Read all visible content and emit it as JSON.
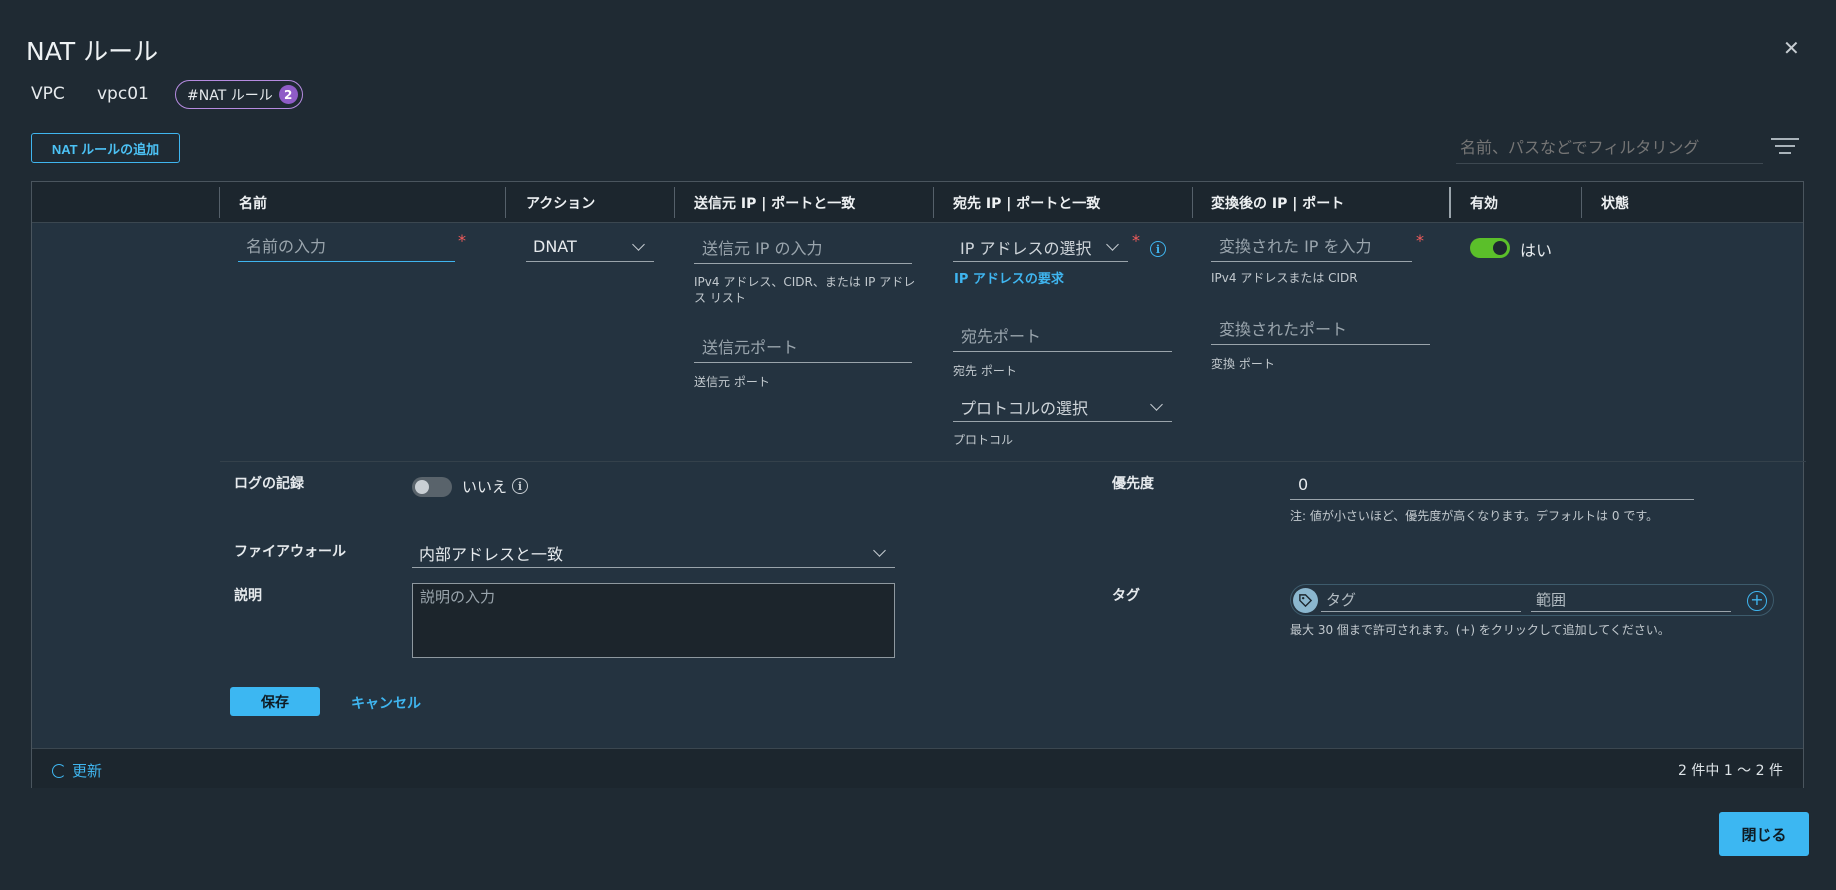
{
  "dialog": {
    "title": "NAT ルール",
    "close_icon": "close-icon",
    "close_button": "閉じる"
  },
  "breadcrumb": {
    "vpc_label": "VPC",
    "vpc_name": "vpc01",
    "chip_label": "#NAT ルール",
    "chip_count": "2"
  },
  "toolbar": {
    "add_button": "NAT ルールの追加",
    "filter_placeholder": "名前、パスなどでフィルタリング"
  },
  "columns": [
    "名前",
    "アクション",
    "送信元 IP | ポートと一致",
    "宛先 IP | ポートと一致",
    "変換後の IP | ポート",
    "有効",
    "状態"
  ],
  "row": {
    "name_placeholder": "名前の入力",
    "action_value": "DNAT",
    "source_ip_placeholder": "送信元 IP の入力",
    "source_ip_help": "IPv4 アドレス、CIDR、または IP アドレス リスト",
    "source_port_placeholder": "送信元ポート",
    "source_port_help": "送信元 ポート",
    "dest_ip_select": "IP アドレスの選択",
    "dest_ip_required_msg": "IP アドレスの要求",
    "dest_port_placeholder": "宛先ポート",
    "dest_port_help": "宛先 ポート",
    "protocol_select": "プロトコルの選択",
    "protocol_help": "プロトコル",
    "translated_ip_placeholder": "変換された IP を入力",
    "translated_ip_help": "IPv4 アドレスまたは CIDR",
    "translated_port_placeholder": "変換されたポート",
    "translated_port_help": "変換 ポート",
    "enabled": "はい",
    "required_mark": "*"
  },
  "details": {
    "logging_label": "ログの記録",
    "logging_value": "いいえ",
    "priority_label": "優先度",
    "priority_value": "0",
    "priority_note": "注: 値が小さいほど、優先度が高くなります。デフォルトは 0 です。",
    "firewall_label": "ファイアウォール",
    "firewall_value": "内部アドレスと一致",
    "description_label": "説明",
    "description_placeholder": "説明の入力",
    "tag_label": "タグ",
    "tag_placeholder": "タグ",
    "scope_placeholder": "範囲",
    "tag_note": "最大 30 個まで許可されます。(+) をクリックして追加してください。",
    "save_button": "保存",
    "cancel_button": "キャンセル"
  },
  "footer": {
    "refresh": "更新",
    "count": "2 件中 1 ～ 2 件"
  },
  "colors": {
    "accent": "#3fb5ef",
    "toggle_on": "#5bbf2a",
    "required": "#f25c5c",
    "chip_badge": "#8f5cc7"
  }
}
